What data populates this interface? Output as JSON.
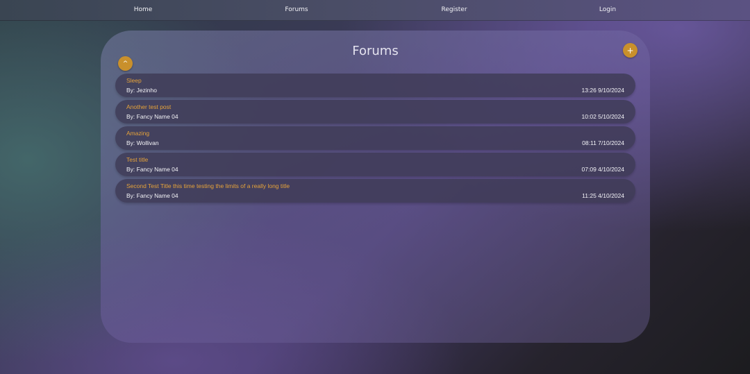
{
  "nav": {
    "home": "Home",
    "forums": "Forums",
    "register": "Register",
    "login": "Login"
  },
  "panel": {
    "title": "Forums",
    "collapse_icon": "^",
    "add_icon": "+"
  },
  "posts": [
    {
      "title": "Sleep",
      "author": "By: Jezinho",
      "timestamp": "13:26 9/10/2024"
    },
    {
      "title": "Another test post",
      "author": "By: Fancy Name 04",
      "timestamp": "10:02 5/10/2024"
    },
    {
      "title": "Amazing",
      "author": "By: Wollivan",
      "timestamp": "08:11 7/10/2024"
    },
    {
      "title": "Test title",
      "author": "By: Fancy Name 04",
      "timestamp": "07:09 4/10/2024"
    },
    {
      "title": "Second Test Title this time testing the limits of a really long title",
      "author": "By: Fancy Name 04",
      "timestamp": "11:25 4/10/2024"
    }
  ],
  "colors": {
    "accent": "#c9902c",
    "post_title": "#e6a33a",
    "post_background": "#3e3a56"
  }
}
